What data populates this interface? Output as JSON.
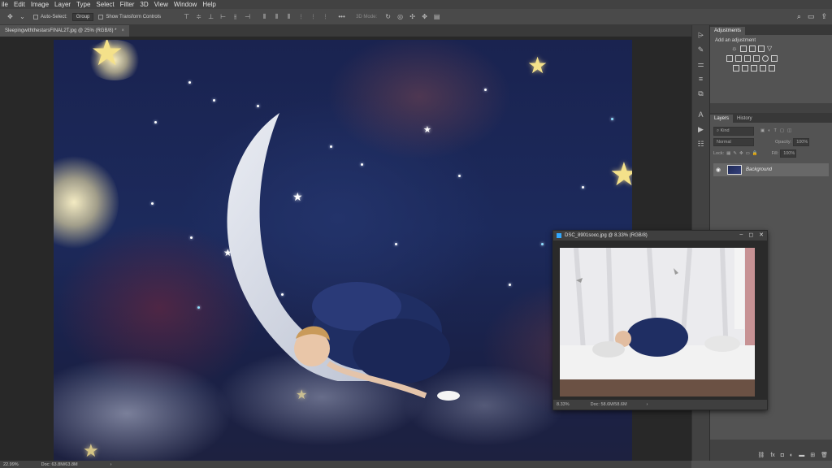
{
  "menu": [
    "ile",
    "Edit",
    "Image",
    "Layer",
    "Type",
    "Select",
    "Filter",
    "3D",
    "View",
    "Window",
    "Help"
  ],
  "options": {
    "auto_select_label": "Auto-Select:",
    "auto_select_value": "Group",
    "transform_controls_label": "Show Transform Controls",
    "mode_3d_label": "3D Mode:"
  },
  "document_tab": {
    "title": "SleepingwiththestarsFINAL2T.jpg @ 25% (RGB/8) *",
    "close": "×"
  },
  "floating_window": {
    "title": "DSC_8901sooc.jpg @ 8.33% (RGB/8)",
    "minimize": "–",
    "maximize": "◻",
    "close": "✕",
    "zoom": "8.33%",
    "doc_info": "Doc: 58.6M/58.6M",
    "arrow": "›"
  },
  "adjustments_panel": {
    "tab": "Adjustments",
    "add_label": "Add an adjustment"
  },
  "layers_panel": {
    "tabs": [
      "Layers",
      "History"
    ],
    "kind": "Kind",
    "blend_mode": "Normal",
    "opacity_label": "Opacity:",
    "opacity_value": "100%",
    "lock_label": "Lock:",
    "fill_label": "Fill:",
    "fill_value": "100%",
    "layer_name": "Background"
  },
  "status_bar": {
    "zoom": "22.99%",
    "doc_info": "Doc: 63.8M/63.8M",
    "arrow": "›"
  },
  "icons": {
    "search": "search-icon",
    "workspace": "workspace-icon",
    "share": "share-icon"
  }
}
